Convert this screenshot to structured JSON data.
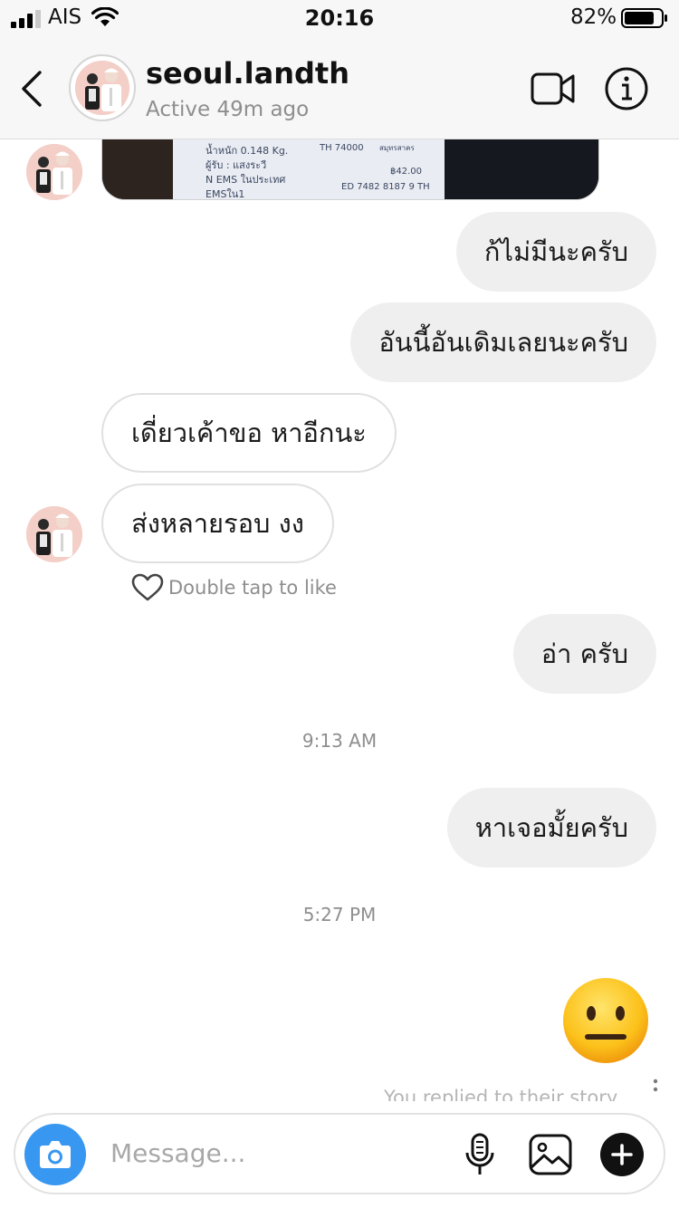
{
  "status_bar": {
    "carrier": "AIS",
    "time": "20:16",
    "battery_percent": "82%",
    "battery_level": 0.82
  },
  "header": {
    "username": "seoul.landth",
    "presence": "Active 49m ago"
  },
  "messages": [
    {
      "direction": "out",
      "text": "ก้ไม่มีนะครับ"
    },
    {
      "direction": "out",
      "text": "อันนี้อันเดิมเลยนะครับ"
    },
    {
      "direction": "in",
      "text": "เดี่ยวเค้าขอ หาอีกนะ"
    },
    {
      "direction": "in",
      "text": "ส่งหลายรอบ งง"
    },
    {
      "direction": "out",
      "text": "อ่า ครับ"
    },
    {
      "direction": "out",
      "text": "หาเจอมั้ยครับ"
    }
  ],
  "photo_receipt": {
    "lines": [
      "น้ำหนัก 0.148 Kg.",
      "TH 74000",
      "สมุทรสาคร",
      "ผู้รับ : แสงระวี",
      "฿42.00",
      "N EMS ในประเทศ",
      "ED 7482 8187 9 TH",
      "EMSใน1"
    ]
  },
  "double_tap_hint": "Double tap to like",
  "timestamps": [
    "9:13 AM",
    "5:27 PM"
  ],
  "sent_emoji": "neutral-face",
  "story_reply_note": "You replied to their story",
  "composer": {
    "placeholder": "Message..."
  },
  "colors": {
    "outgoing_bubble": "#efefef",
    "incoming_border": "#e0e0e0",
    "camera_button": "#3897f0",
    "muted_text": "#8e8e8e"
  }
}
